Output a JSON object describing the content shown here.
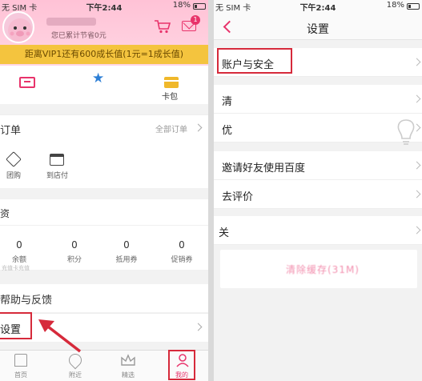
{
  "left": {
    "status": {
      "carrier": "无 SIM 卡",
      "time": "下午2:44",
      "battery": "18%"
    },
    "header": {
      "saving_text": "您已累计节省0元",
      "mail_badge": "1",
      "vip_text": "距离VIP1还有600成长值(1元=1成长值)"
    },
    "quick": {
      "card_label": "卡包"
    },
    "orders": {
      "title": "订单",
      "view_all": "全部订单",
      "items": [
        {
          "label": "团购"
        },
        {
          "label": "到店付"
        }
      ]
    },
    "assets": {
      "title": "资",
      "items": [
        {
          "value": "0",
          "label": "余额",
          "sub": "充值卡充值"
        },
        {
          "value": "0",
          "label": "积分"
        },
        {
          "value": "0",
          "label": "抵用券"
        },
        {
          "value": "0",
          "label": "促销券"
        }
      ]
    },
    "help": {
      "label": "帮助与反馈"
    },
    "settings": {
      "label": "设置"
    },
    "tabbar": [
      {
        "label": "首页"
      },
      {
        "label": "附近"
      },
      {
        "label": "精选"
      },
      {
        "label": "我的"
      }
    ]
  },
  "right": {
    "status": {
      "carrier": "无 SIM 卡",
      "time": "下午2:44",
      "battery": "18%"
    },
    "nav_title": "设置",
    "rows": [
      {
        "label": "账户与安全"
      },
      {
        "label": "清"
      },
      {
        "label": "优"
      },
      {
        "label": "邀请好友使用百度"
      },
      {
        "label": "去评价"
      },
      {
        "label": "关"
      }
    ],
    "logout_text": "清除缓存(31M)"
  },
  "colors": {
    "accent": "#e8336b",
    "highlight": "#d62a3b",
    "vip": "#f4c43e",
    "header_pink": "#ffc2d6"
  }
}
